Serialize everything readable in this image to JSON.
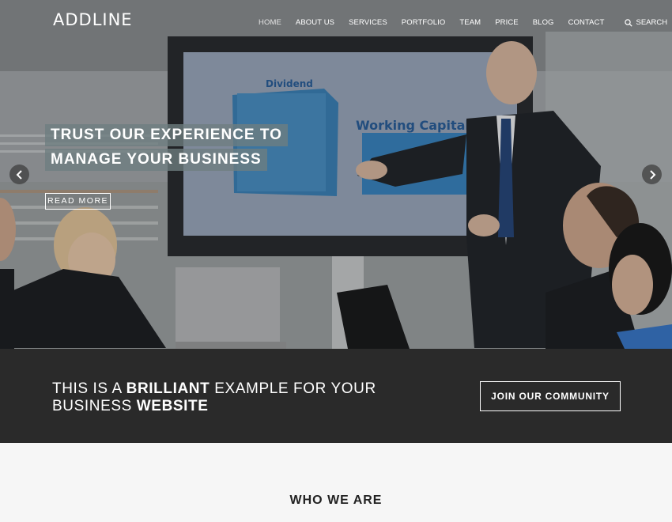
{
  "site": {
    "logo": "ADDLINE"
  },
  "nav": {
    "items": [
      "HOME",
      "ABOUT US",
      "SERVICES",
      "PORTFOLIO",
      "TEAM",
      "PRICE",
      "BLOG",
      "CONTACT"
    ],
    "active": "HOME",
    "search_label": "SEARCH"
  },
  "hero": {
    "headline_line1": "TRUST OUR EXPERIENCE TO",
    "headline_line2": "MANAGE YOUR BUSINESS",
    "read_more": "READ MORE",
    "screen_labels": [
      "Dividend",
      "Working Capital"
    ]
  },
  "cta": {
    "text_part1": "THIS IS A ",
    "text_bold1": "BRILLIANT",
    "text_part2": " EXAMPLE FOR YOUR",
    "text_part3": "BUSINESS ",
    "text_bold2": "WEBSITE",
    "button": "JOIN OUR COMMUNITY"
  },
  "who": {
    "title": "WHO WE ARE"
  },
  "icons": {
    "search": "search-icon",
    "prev": "chevron-left-icon",
    "next": "chevron-right-icon"
  },
  "colors": {
    "cta_bg": "#2a2a2a",
    "headline_bg": "#6e7d80",
    "page_bg": "#f6f6f6"
  }
}
